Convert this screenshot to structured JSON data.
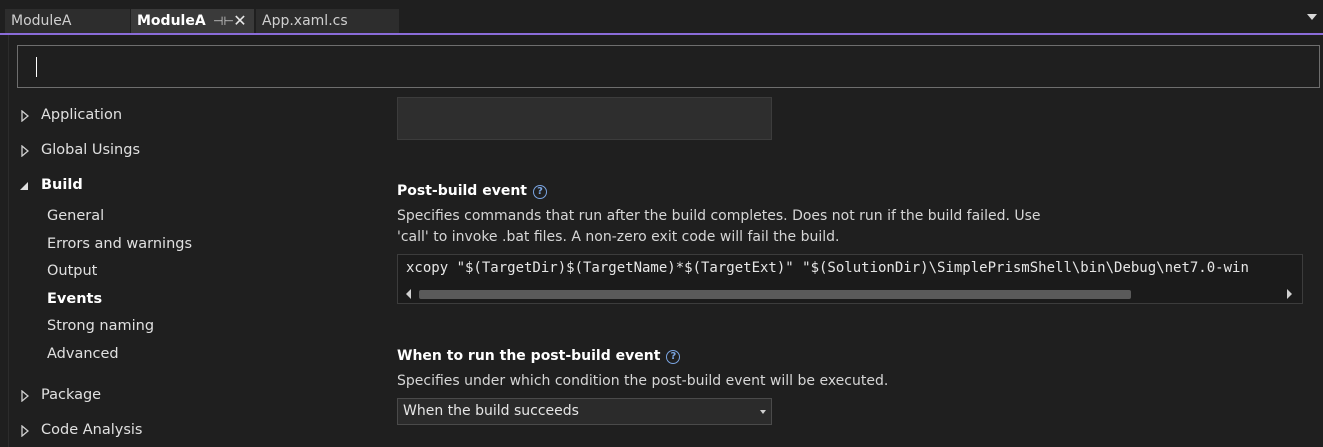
{
  "tabs": [
    {
      "label": "ModuleA"
    },
    {
      "label": "ModuleA",
      "pin_glyph": "⊣⊢",
      "close_glyph": "✕"
    },
    {
      "label": "App.xaml.cs"
    }
  ],
  "search": {
    "value": ""
  },
  "nav": {
    "groups": [
      {
        "label": "Application"
      },
      {
        "label": "Global Usings"
      },
      {
        "label": "Build"
      },
      {
        "label": "Package"
      },
      {
        "label": "Code Analysis"
      }
    ],
    "build_items": [
      {
        "label": "General"
      },
      {
        "label": "Errors and warnings"
      },
      {
        "label": "Output"
      },
      {
        "label": "Events"
      },
      {
        "label": "Strong naming"
      },
      {
        "label": "Advanced"
      }
    ]
  },
  "post_build": {
    "title": "Post-build event",
    "help": "?",
    "desc_line1": "Specifies commands that run after the build completes. Does not run if the build failed. Use",
    "desc_line2": "'call' to invoke .bat files. A non-zero exit code will fail the build.",
    "command": "xcopy \"$(TargetDir)$(TargetName)*$(TargetExt)\" \"$(SolutionDir)\\SimplePrismShell\\bin\\Debug\\net7.0-win"
  },
  "when_run": {
    "title": "When to run the post-build event",
    "help": "?",
    "desc": "Specifies under which condition the post-build event will be executed.",
    "selected": "When the build succeeds"
  },
  "colors": {
    "accent": "#8a6cd9",
    "help_icon": "#7aa4e0"
  }
}
